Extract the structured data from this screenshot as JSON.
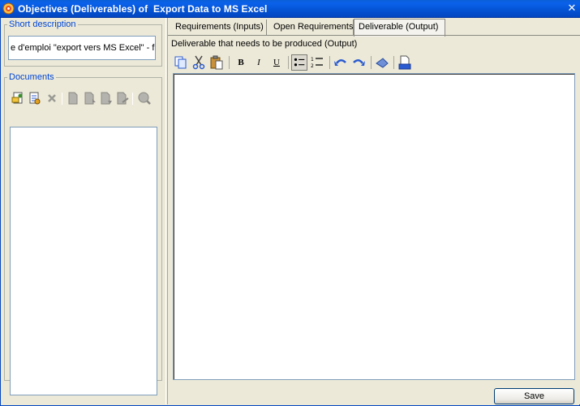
{
  "window": {
    "title": "Objectives (Deliverables) of  Export Data to MS Excel",
    "close_glyph": "✕"
  },
  "short_description": {
    "title": "Short description",
    "value": "e d'emploi \"export vers MS Excel\" - fr"
  },
  "documents": {
    "title": "Documents",
    "toolbar": [
      "add-document-icon",
      "link-document-icon",
      "delete-icon",
      "document-icon",
      "document-upload-icon",
      "document-download-icon",
      "document-edit-icon",
      "search-document-icon"
    ]
  },
  "tabs": [
    {
      "label": "Requirements (Inputs)"
    },
    {
      "label": "Open Requirements"
    },
    {
      "label": "Deliverable (Output)"
    }
  ],
  "deliverable": {
    "label": "Deliverable that needs to be produced (Output)"
  },
  "editor_toolbar": {
    "bold": "B",
    "italic": "I",
    "underline": "U"
  },
  "footer": {
    "save_label": "Save"
  },
  "colors": {
    "titlebar": "#0453d4",
    "group_title": "#0046d5",
    "background": "#ece9d8"
  }
}
